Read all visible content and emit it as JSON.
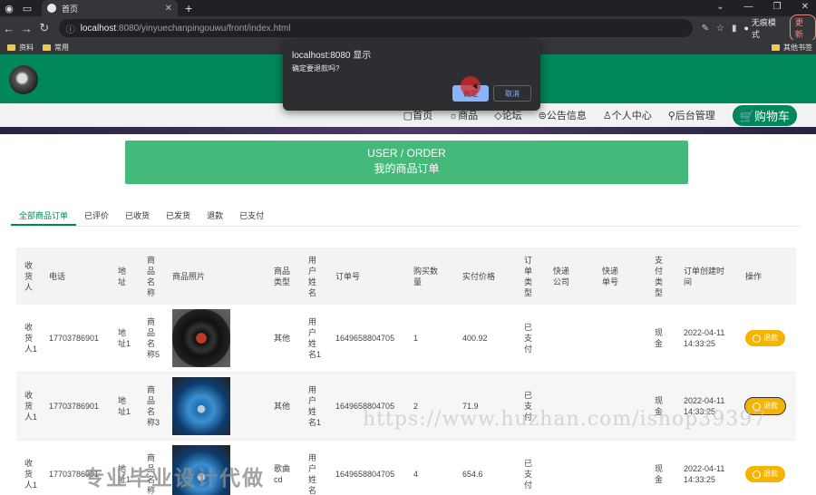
{
  "browser": {
    "tab_title": "首页",
    "url_host": "localhost",
    "url_path": ":8080/yinyuechanpingouwu/front/index.html",
    "incognito_label": "无痕模式",
    "update_label": "更新",
    "bookmarks": [
      "资料",
      "常用"
    ],
    "bookmark_right": "其他书签"
  },
  "nav": {
    "items": [
      "首页",
      "商品",
      "论坛",
      "公告信息",
      "个人中心",
      "后台管理"
    ],
    "cart": "购物车"
  },
  "banner": {
    "line1": "USER / ORDER",
    "line2": "我的商品订单"
  },
  "order_tabs": [
    "全部商品订单",
    "已评价",
    "已收货",
    "已发货",
    "退款",
    "已支付"
  ],
  "table": {
    "headers": [
      "收货人",
      "电话",
      "地址",
      "商品名称",
      "商品照片",
      "商品类型",
      "用户姓名",
      "订单号",
      "购买数量",
      "实付价格",
      "订单类型",
      "快递公司",
      "快递单号",
      "支付类型",
      "订单创建时间",
      "操作"
    ],
    "rows": [
      {
        "receiver": "收货人1",
        "phone": "17703786901",
        "address": "地址1",
        "product": "商品名称5",
        "type": "其他",
        "user": "用户姓名1",
        "order_no": "1649658804705",
        "qty": "1",
        "price": "400.92",
        "order_type": "已支付",
        "pay_type": "现金",
        "created": "2022-04-11 14:33:25",
        "action": "退款"
      },
      {
        "receiver": "收货人1",
        "phone": "17703786901",
        "address": "地址1",
        "product": "商品名称3",
        "type": "其他",
        "user": "用户姓名1",
        "order_no": "1649658804705",
        "qty": "2",
        "price": "71.9",
        "order_type": "已支付",
        "pay_type": "现金",
        "created": "2022-04-11 14:33:25",
        "action": "退款"
      },
      {
        "receiver": "收货人1",
        "phone": "17703786901",
        "address": "地址1",
        "product": "商品名称",
        "type": "歌曲cd",
        "user": "用户姓名",
        "order_no": "1649658804705",
        "qty": "4",
        "price": "654.6",
        "order_type": "已支付",
        "pay_type": "现金",
        "created": "2022-04-11 14:33:25",
        "action": "退款"
      }
    ]
  },
  "dialog": {
    "title": "localhost:8080 显示",
    "message": "确定要退款吗?",
    "ok": "确定",
    "cancel": "取消"
  },
  "watermarks": {
    "url": "https://www.huzhan.com/ishop39397",
    "text": "专业毕业设计代做"
  }
}
